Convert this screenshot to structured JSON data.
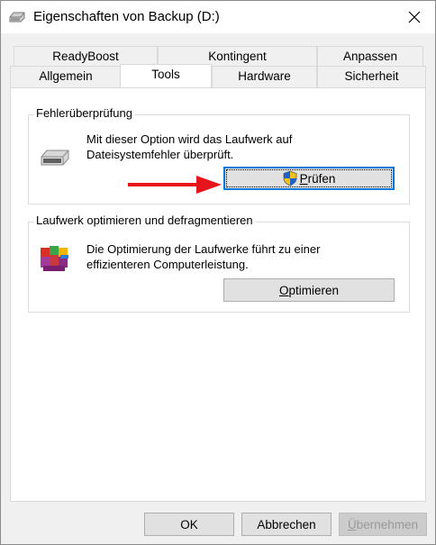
{
  "window": {
    "title": "Eigenschaften von Backup (D:)"
  },
  "tabs": {
    "row1": [
      "ReadyBoost",
      "Kontingent",
      "Anpassen"
    ],
    "row2": [
      "Allgemein",
      "Tools",
      "Hardware",
      "Sicherheit"
    ],
    "active": "Tools"
  },
  "error_check": {
    "title": "Fehlerüberprüfung",
    "line1": "Mit dieser Option wird das Laufwerk auf",
    "line2": "Dateisystemfehler überprüft.",
    "button": {
      "underlined": "P",
      "rest": "rüfen"
    }
  },
  "optimize": {
    "title": "Laufwerk optimieren und defragmentieren",
    "line1": "Die Optimierung der Laufwerke führt zu einer",
    "line2": "effizienteren Computerleistung.",
    "button": {
      "underlined": "O",
      "rest": "ptimieren"
    }
  },
  "footer": {
    "ok": "OK",
    "cancel": "Abbrechen",
    "apply": {
      "underlined": "Ü",
      "rest": "bernehmen"
    }
  },
  "colors": {
    "arrow": "#e8141b",
    "focus": "#0078d7"
  }
}
